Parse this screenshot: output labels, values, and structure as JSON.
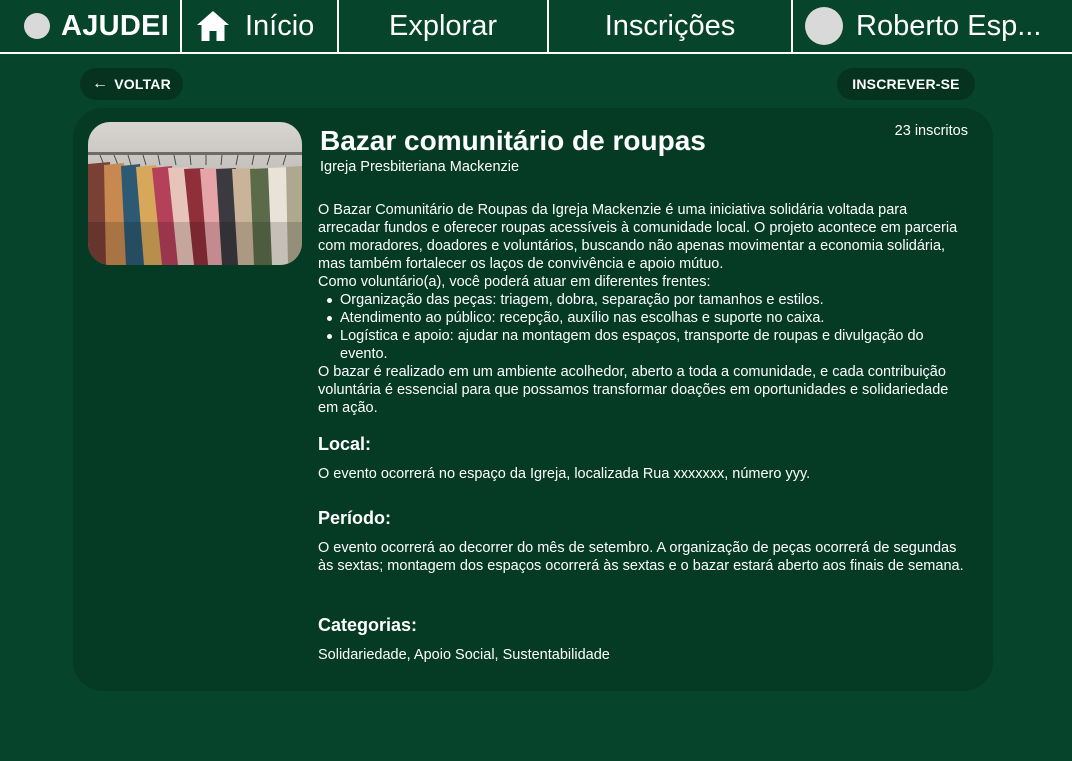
{
  "nav": {
    "brand": "AJUDEI",
    "inicio": "Início",
    "explorar": "Explorar",
    "inscricoes": "Inscrições",
    "user": "Roberto Esp..."
  },
  "actions": {
    "back": "VOLTAR",
    "subscribe": "INSCREVER-SE"
  },
  "event": {
    "title": "Bazar comunitário de roupas",
    "organization": "Igreja Presbiteriana Mackenzie",
    "subscribers": "23 inscritos",
    "description_p1": "O Bazar Comunitário de Roupas da Igreja Mackenzie é uma iniciativa solidária voltada para arrecadar fundos e oferecer roupas acessíveis à comunidade local. O projeto acontece em parceria com moradores, doadores e voluntários, buscando não apenas movimentar a economia solidária, mas também fortalecer os laços de convivência e apoio mútuo.",
    "description_p2": "Como voluntário(a), você poderá atuar em diferentes frentes:",
    "tasks": [
      "Organização das peças: triagem, dobra, separação por tamanhos e estilos.",
      "Atendimento ao público: recepção, auxílio nas escolhas e suporte no caixa.",
      "Logística e apoio: ajudar na montagem dos espaços, transporte de roupas e divulgação do evento."
    ],
    "description_p3": "O bazar é realizado em um ambiente acolhedor, aberto a toda a comunidade, e cada contribuição voluntária é essencial para que possamos transformar doações em oportunidades e solidariedade em ação.",
    "local_heading": "Local:",
    "local_text": "O evento ocorrerá no espaço da Igreja, localizada Rua xxxxxxx, número yyy.",
    "period_heading": "Período:",
    "period_text": "O evento ocorrerá ao decorrer do mês de setembro. A organização de peças ocorrerá de segundas às sextas; montagem dos espaços ocorrerá às sextas e o bazar estará aberto aos finais de semana.",
    "categories_heading": "Categorias:",
    "categories_text": "Solidariedade, Apoio Social, Sustentabilidade"
  },
  "icons": {
    "home": "home-icon",
    "back": "arrow-left-icon"
  },
  "colors": {
    "background": "#06442c",
    "card": "#053a24",
    "pill": "#063320",
    "text": "#ffffff",
    "avatar": "#d9d9d9"
  }
}
